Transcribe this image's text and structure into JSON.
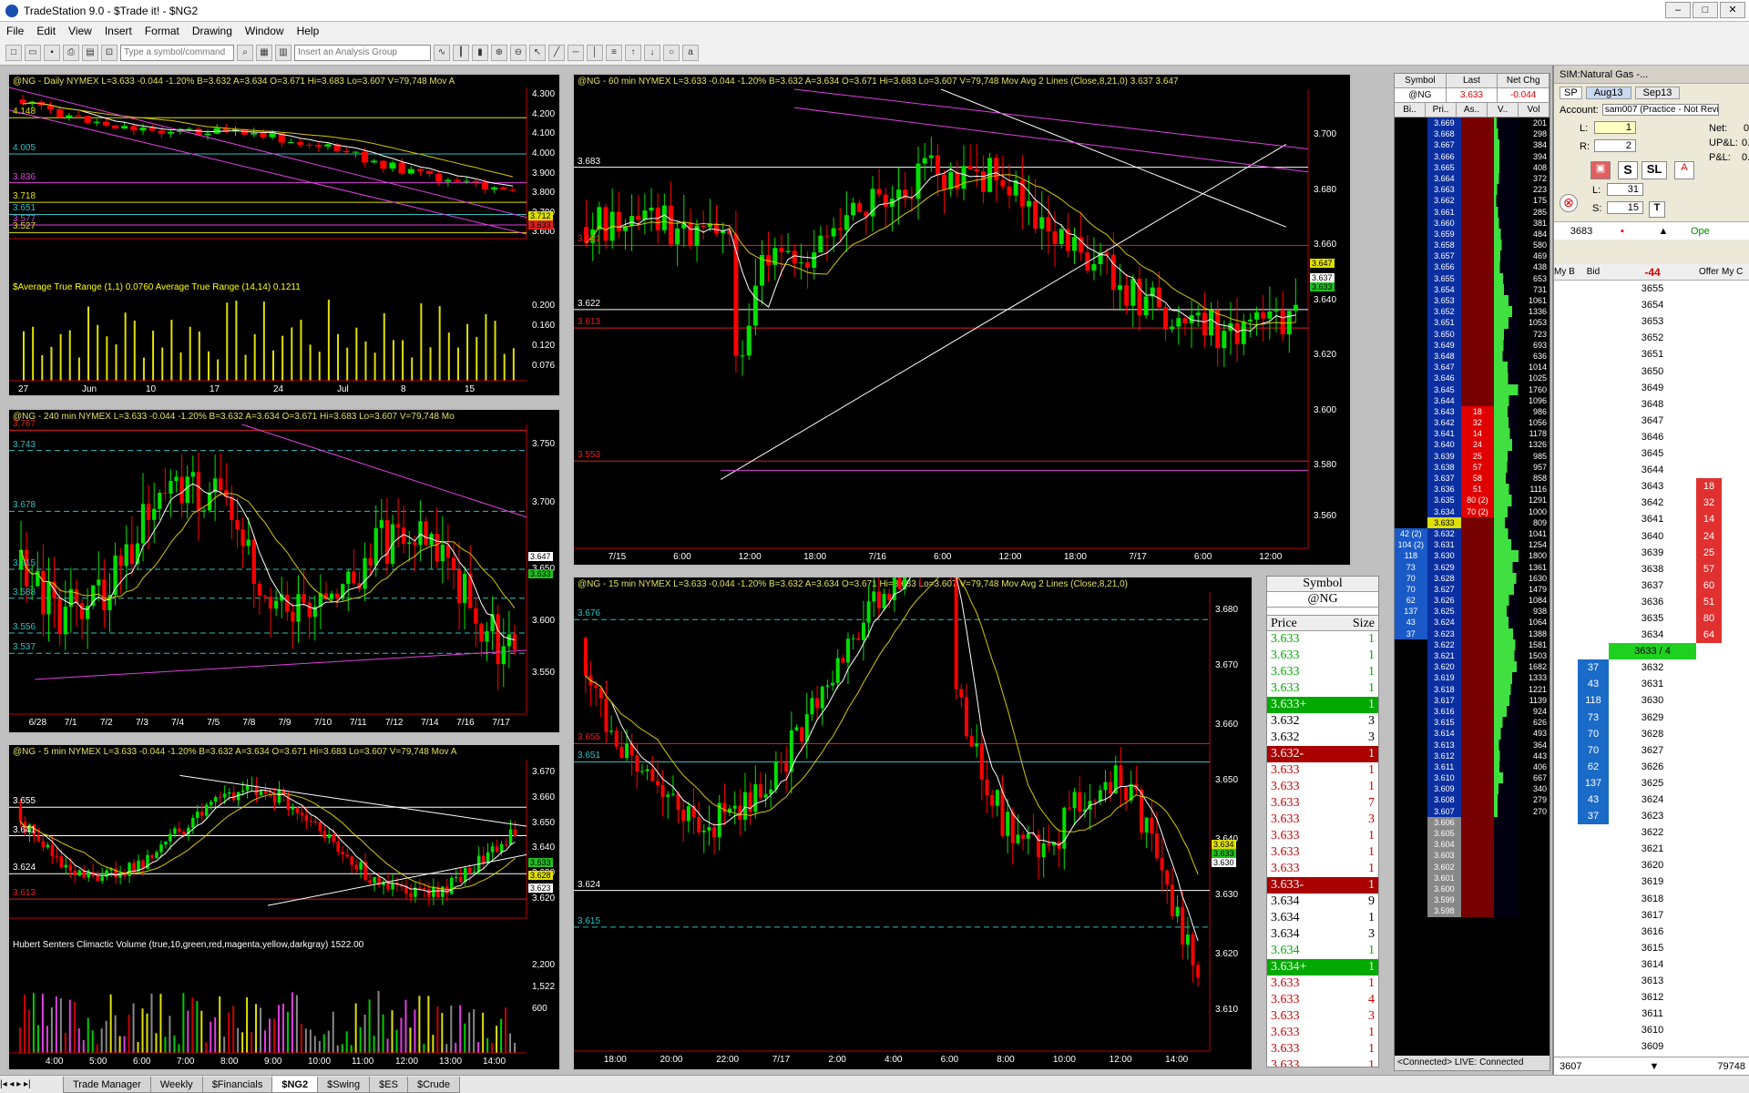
{
  "app": {
    "title": "TradeStation 9.0 - $Trade it! - $NG2"
  },
  "menu": [
    "File",
    "Edit",
    "View",
    "Insert",
    "Format",
    "Drawing",
    "Window",
    "Help"
  ],
  "toolbar": {
    "symbol_placeholder": "Type a symbol/command",
    "analysis_placeholder": "Insert an Analysis Group"
  },
  "charts": {
    "daily": {
      "header": "@NG - Daily  NYMEX  L=3.633  -0.044  -1.20%  B=3.632  A=3.634  O=3.671  Hi=3.683  Lo=3.607  V=79,748  Mov A",
      "levels": [
        "4.148",
        "4.005",
        "3.836",
        "3.718",
        "3.651",
        "3.577",
        "3.527"
      ],
      "yaxis": [
        "4.300",
        "4.200",
        "4.100",
        "4.000",
        "3.900",
        "3.800",
        "3.700",
        "3.600"
      ],
      "price_tags": [
        "3.712",
        "3.633"
      ],
      "atr_header": "$Average True Range (1,1)  0.0760  Average True Range (14,14)  0.1211",
      "atr_axis": [
        "0.200",
        "0.160",
        "0.120",
        "0.076"
      ],
      "xaxis": [
        "27",
        "Jun",
        "10",
        "17",
        "24",
        "Jul",
        "8",
        "15"
      ]
    },
    "h240": {
      "header": "@NG - 240 min  NYMEX  L=3.633  -0.044  -1.20%  B=3.632  A=3.634  O=3.671  Hi=3.683  Lo=3.607  V=79,748  Mo",
      "levels": [
        "3.767",
        "3.743",
        "3.678",
        "3.615",
        "3.588",
        "3.556",
        "3.537"
      ],
      "yaxis": [
        "3.750",
        "3.700",
        "3.650",
        "3.600",
        "3.550"
      ],
      "price_tags": [
        "3.647",
        "3.633"
      ],
      "xaxis": [
        "6/28",
        "7/1",
        "7/2",
        "7/3",
        "7/4",
        "7/5",
        "7/8",
        "7/9",
        "7/10",
        "7/11",
        "7/12",
        "7/14",
        "7/16",
        "7/17"
      ]
    },
    "m5": {
      "header": "@NG - 5 min  NYMEX  L=3.633  -0.044  -1.20%  B=3.632  A=3.634  O=3.671  Hi=3.683  Lo=3.607  V=79,748  Mov A",
      "levels": [
        "3.655",
        "3.641",
        "3.624",
        "3.613"
      ],
      "yaxis": [
        "3.670",
        "3.660",
        "3.650",
        "3.640",
        "3.630",
        "3.620"
      ],
      "price_tags": [
        "3.633",
        "3.628",
        "3.623"
      ],
      "vol_header": "Hubert Senters Climactic Volume (true,10,green,red,magenta,yellow,darkgray)  1522.00",
      "vol_axis": [
        "2,200",
        "1,522",
        "600"
      ],
      "xaxis": [
        "4:00",
        "5:00",
        "6:00",
        "7:00",
        "8:00",
        "9:00",
        "10:00",
        "11:00",
        "12:00",
        "13:00",
        "14:00"
      ]
    },
    "m60": {
      "header": "@NG - 60 min  NYMEX  L=3.633  -0.044  -1.20%  B=3.632  A=3.634  O=3.671  Hi=3.683  Lo=3.607  V=79,748  Mov Avg 2 Lines (Close,8,21,0)  3.637  3.647",
      "levels": [
        "3.683",
        "3.651",
        "3.622",
        "3.613",
        "3.553"
      ],
      "yaxis": [
        "3.700",
        "3.680",
        "3.660",
        "3.640",
        "3.620",
        "3.600",
        "3.580",
        "3.560"
      ],
      "price_tags": [
        "3.647",
        "3.637",
        "3.633"
      ],
      "xaxis": [
        "7/15",
        "6:00",
        "12:00",
        "18:00",
        "7/16",
        "6:00",
        "12:00",
        "18:00",
        "7/17",
        "6:00",
        "12:00"
      ]
    },
    "m15": {
      "header": "@NG - 15 min  NYMEX  L=3.633  -0.044  -1.20%  B=3.632  A=3.634  O=3.671  Hi=3.683  Lo=3.607  V=79,748  Mov Avg 2 Lines (Close,8,21,0)",
      "levels": [
        "3.676",
        "3.655",
        "3.651",
        "3.624",
        "3.615"
      ],
      "yaxis": [
        "3.680",
        "3.670",
        "3.660",
        "3.650",
        "3.640",
        "3.630",
        "3.620",
        "3.610"
      ],
      "price_tags": [
        "3.634",
        "3.633",
        "3.630"
      ],
      "xaxis": [
        "18:00",
        "20:00",
        "22:00",
        "7/17",
        "2:00",
        "4:00",
        "6:00",
        "8:00",
        "10:00",
        "12:00",
        "14:00"
      ]
    }
  },
  "matrix": {
    "headers": [
      "Symbol",
      "Last",
      "Net Chg"
    ],
    "symbol": "@NG",
    "last": "3.633",
    "net_chg": "-0.044",
    "sub_headers": [
      "Bi..",
      "Pri..",
      "As..",
      "V..",
      "Vol"
    ],
    "rows": [
      [
        "3.669",
        "201"
      ],
      [
        "3.668",
        "298"
      ],
      [
        "3.667",
        "384"
      ],
      [
        "3.666",
        "394"
      ],
      [
        "3.665",
        "408"
      ],
      [
        "3.664",
        "372"
      ],
      [
        "3.663",
        "223"
      ],
      [
        "3.662",
        "175"
      ],
      [
        "3.661",
        "285"
      ],
      [
        "3.660",
        "381"
      ],
      [
        "3.659",
        "484"
      ],
      [
        "3.658",
        "580"
      ],
      [
        "3.657",
        "469"
      ],
      [
        "3.656",
        "438"
      ],
      [
        "3.655",
        "653"
      ],
      [
        "3.654",
        "731"
      ],
      [
        "3.653",
        "1061"
      ],
      [
        "3.652",
        "1336"
      ],
      [
        "3.651",
        "1053"
      ],
      [
        "3.650",
        "723"
      ],
      [
        "3.649",
        "693"
      ],
      [
        "3.648",
        "636"
      ],
      [
        "3.647",
        "1014"
      ],
      [
        "3.646",
        "1025"
      ],
      [
        "3.645",
        "1760"
      ],
      [
        "3.644",
        "1096"
      ],
      [
        "3.643",
        "986"
      ],
      [
        "3.642",
        "1056"
      ],
      [
        "3.641",
        "1178"
      ],
      [
        "3.640",
        "1326"
      ],
      [
        "3.639",
        "985"
      ],
      [
        "3.638",
        "957"
      ],
      [
        "3.637",
        "858"
      ],
      [
        "3.636",
        "1116"
      ],
      [
        "3.635",
        "1291"
      ],
      [
        "3.634",
        "1000"
      ],
      [
        "3.633",
        "809"
      ],
      [
        "3.632",
        "1041"
      ],
      [
        "3.631",
        "1254"
      ],
      [
        "3.630",
        "1800"
      ],
      [
        "3.629",
        "1361"
      ],
      [
        "3.628",
        "1630"
      ],
      [
        "3.627",
        "1479"
      ],
      [
        "3.626",
        "1084"
      ],
      [
        "3.625",
        "938"
      ],
      [
        "3.624",
        "1064"
      ],
      [
        "3.623",
        "1388"
      ],
      [
        "3.622",
        "1581"
      ],
      [
        "3.621",
        "1503"
      ],
      [
        "3.620",
        "1682"
      ],
      [
        "3.619",
        "1333"
      ],
      [
        "3.618",
        "1221"
      ],
      [
        "3.617",
        "1139"
      ],
      [
        "3.616",
        "924"
      ],
      [
        "3.615",
        "626"
      ],
      [
        "3.614",
        "493"
      ],
      [
        "3.613",
        "364"
      ],
      [
        "3.612",
        "443"
      ],
      [
        "3.611",
        "406"
      ],
      [
        "3.610",
        "667"
      ],
      [
        "3.609",
        "340"
      ],
      [
        "3.608",
        "279"
      ],
      [
        "3.607",
        "270"
      ],
      [
        "3.606",
        ""
      ],
      [
        "3.605",
        ""
      ],
      [
        "3.604",
        ""
      ],
      [
        "3.603",
        ""
      ],
      [
        "3.602",
        ""
      ],
      [
        "3.601",
        ""
      ],
      [
        "3.600",
        ""
      ],
      [
        "3.599",
        ""
      ],
      [
        "3.598",
        ""
      ]
    ],
    "asks": {
      "3.643": "18",
      "3.642": "32",
      "3.641": "14",
      "3.640": "24",
      "3.639": "25",
      "3.638": "57",
      "3.637": "58",
      "3.636": "51",
      "3.635": "80 (2)",
      "3.634": "70 (2)"
    },
    "bids": {
      "3.632": "42 (2)",
      "3.631": "104 (2)",
      "3.630": "118",
      "3.629": "73",
      "3.628": "70",
      "3.627": "70",
      "3.626": "62",
      "3.625": "137",
      "3.624": "43",
      "3.623": "37"
    },
    "status": "<Connected> LIVE: Connected"
  },
  "timesales": {
    "symbol_label": "Symbol",
    "symbol": "@NG",
    "price_label": "Price",
    "size_label": "Size",
    "rows": [
      [
        "3.633",
        "1",
        "g"
      ],
      [
        "3.633",
        "1",
        "g"
      ],
      [
        "3.633",
        "1",
        "g"
      ],
      [
        "3.633",
        "1",
        "g"
      ],
      [
        "3.633+",
        "1",
        "G"
      ],
      [
        "3.632",
        "3",
        "w"
      ],
      [
        "3.632",
        "3",
        "w"
      ],
      [
        "3.632-",
        "1",
        "R"
      ],
      [
        "3.633",
        "1",
        "r"
      ],
      [
        "3.633",
        "1",
        "r"
      ],
      [
        "3.633",
        "7",
        "r"
      ],
      [
        "3.633",
        "3",
        "r"
      ],
      [
        "3.633",
        "1",
        "r"
      ],
      [
        "3.633",
        "1",
        "r"
      ],
      [
        "3.633",
        "1",
        "r"
      ],
      [
        "3.633-",
        "1",
        "R"
      ],
      [
        "3.634",
        "9",
        "w"
      ],
      [
        "3.634",
        "1",
        "w"
      ],
      [
        "3.634",
        "3",
        "w"
      ],
      [
        "3.634",
        "1",
        "g"
      ],
      [
        "3.634+",
        "1",
        "G"
      ],
      [
        "3.633",
        "1",
        "r"
      ],
      [
        "3.633",
        "4",
        "r"
      ],
      [
        "3.633",
        "3",
        "r"
      ],
      [
        "3.633",
        "1",
        "r"
      ],
      [
        "3.633",
        "1",
        "r"
      ],
      [
        "3.633",
        "1",
        "r"
      ],
      [
        "3.633",
        "1",
        "r"
      ]
    ]
  },
  "orderbar": {
    "title": "SIM:Natural Gas -...",
    "contract_sp": "SP",
    "contract1": "Aug13",
    "contract2": "Sep13",
    "account_label": "Account:",
    "account": "sam007 (Practice - Not Revie",
    "net_label": "Net:",
    "net": "0",
    "upl_label": "UP&L:",
    "upl": "0.",
    "pl_label": "P&L:",
    "pl": "0.",
    "l_label": "L:",
    "l_val": "1",
    "r_label": "R:",
    "r_val": "2",
    "l2_label": "L:",
    "l2_val": "31",
    "s_label": "S:",
    "s_val": "15",
    "last_price": "3683",
    "change": "-44",
    "open_label": "Ope",
    "col_headers": [
      "My B",
      "Bid",
      "",
      "Offer",
      "My C"
    ],
    "dom_prices": [
      "3655",
      "3654",
      "3653",
      "3652",
      "3651",
      "3650",
      "3649",
      "3648",
      "3647",
      "3646",
      "3645",
      "3644",
      "3643",
      "3642",
      "3641",
      "3640",
      "3639",
      "3638",
      "3637",
      "3636",
      "3635",
      "3634",
      "3633 / 4",
      "3632",
      "3631",
      "3630",
      "3629",
      "3628",
      "3627",
      "3626",
      "3625",
      "3624",
      "3623",
      "3622",
      "3621",
      "3620",
      "3619",
      "3618",
      "3617",
      "3616",
      "3615",
      "3614",
      "3613",
      "3612",
      "3611",
      "3610",
      "3609"
    ],
    "dom_offers": {
      "3643": "18",
      "3642": "32",
      "3641": "14",
      "3640": "24",
      "3639": "25",
      "3638": "57",
      "3637": "60",
      "3636": "51",
      "3635": "80",
      "3634": "64"
    },
    "dom_bids": {
      "3632": "37",
      "3631": "43",
      "3630": "118",
      "3629": "73",
      "3628": "70",
      "3627": "70",
      "3626": "62",
      "3625": "137",
      "3624": "43",
      "3623": "37"
    },
    "footer_left": "3607",
    "footer_right": "79748"
  },
  "tabs": [
    "Trade Manager",
    "Weekly",
    "$Financials",
    "$NG2",
    "$Swing",
    "$ES",
    "$Crude"
  ],
  "active_tab": "$NG2",
  "colors": {
    "up": "#00e000",
    "down": "#ff0000",
    "ma_fast": "#ffffff",
    "ma_slow": "#d6c800",
    "level": "#ffffff",
    "cyan_level": "#30c0c0"
  }
}
